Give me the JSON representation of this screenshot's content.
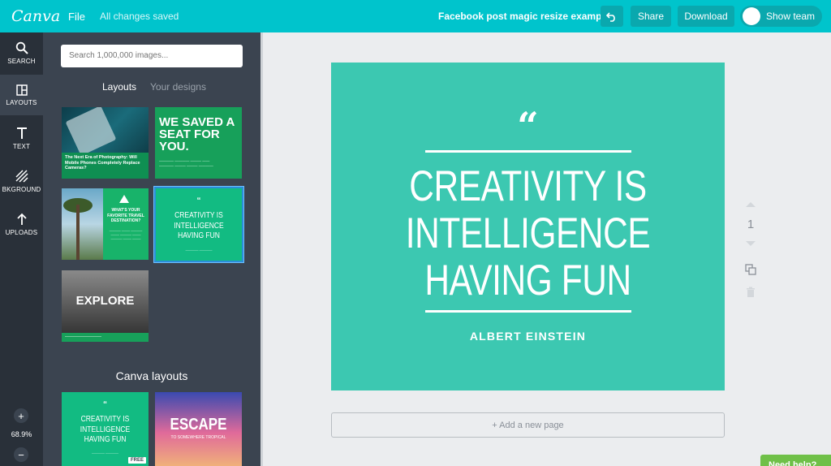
{
  "topbar": {
    "logo": "Canva",
    "file_menu": "File",
    "save_status": "All changes saved",
    "design_title": "Facebook post magic resize example",
    "share_label": "Share",
    "download_label": "Download",
    "show_team_label": "Show team"
  },
  "rail": {
    "items": [
      {
        "label": "SEARCH",
        "icon": "search-icon"
      },
      {
        "label": "LAYOUTS",
        "icon": "layouts-icon"
      },
      {
        "label": "TEXT",
        "icon": "text-icon"
      },
      {
        "label": "BKGROUND",
        "icon": "background-icon"
      },
      {
        "label": "UPLOADS",
        "icon": "upload-icon"
      }
    ],
    "zoom": "68.9%",
    "zoom_in": "+",
    "zoom_out": "−"
  },
  "panel": {
    "search_placeholder": "Search 1,000,000 images...",
    "tab_layouts": "Layouts",
    "tab_designs": "Your designs",
    "section_canva_layouts": "Canva layouts",
    "thumbs": {
      "t1_caption": "The Next Era of Photography: Will Mobile Phones Completely Replace Cameras?",
      "t2_headline": "WE SAVED A SEAT FOR YOU.",
      "t3_question": "WHAT'S YOUR FAVORITE TRAVEL DESTINATION?",
      "t4_text": "CREATIVITY IS INTELLIGENCE HAVING FUN",
      "t5_text": "EXPLORE",
      "t6_text": "CREATIVITY IS INTELLIGENCE HAVING FUN",
      "t6_badge": "FREE",
      "t7_text": "ESCAPE",
      "t7_sub": "TO SOMEWHERE TROPICAL"
    }
  },
  "canvas": {
    "quote_mark": "“",
    "line1": "CREATIVITY IS",
    "line2": "INTELLIGENCE",
    "line3": "HAVING FUN",
    "author": "ALBERT EINSTEIN",
    "page_number": "1",
    "add_page_label": "+ Add a new page"
  },
  "help_label": "Need help?",
  "colors": {
    "brand": "#00c4cc",
    "design_bg": "#3cc8b1",
    "rail_bg": "#293039",
    "panel_bg": "#3b4450"
  }
}
